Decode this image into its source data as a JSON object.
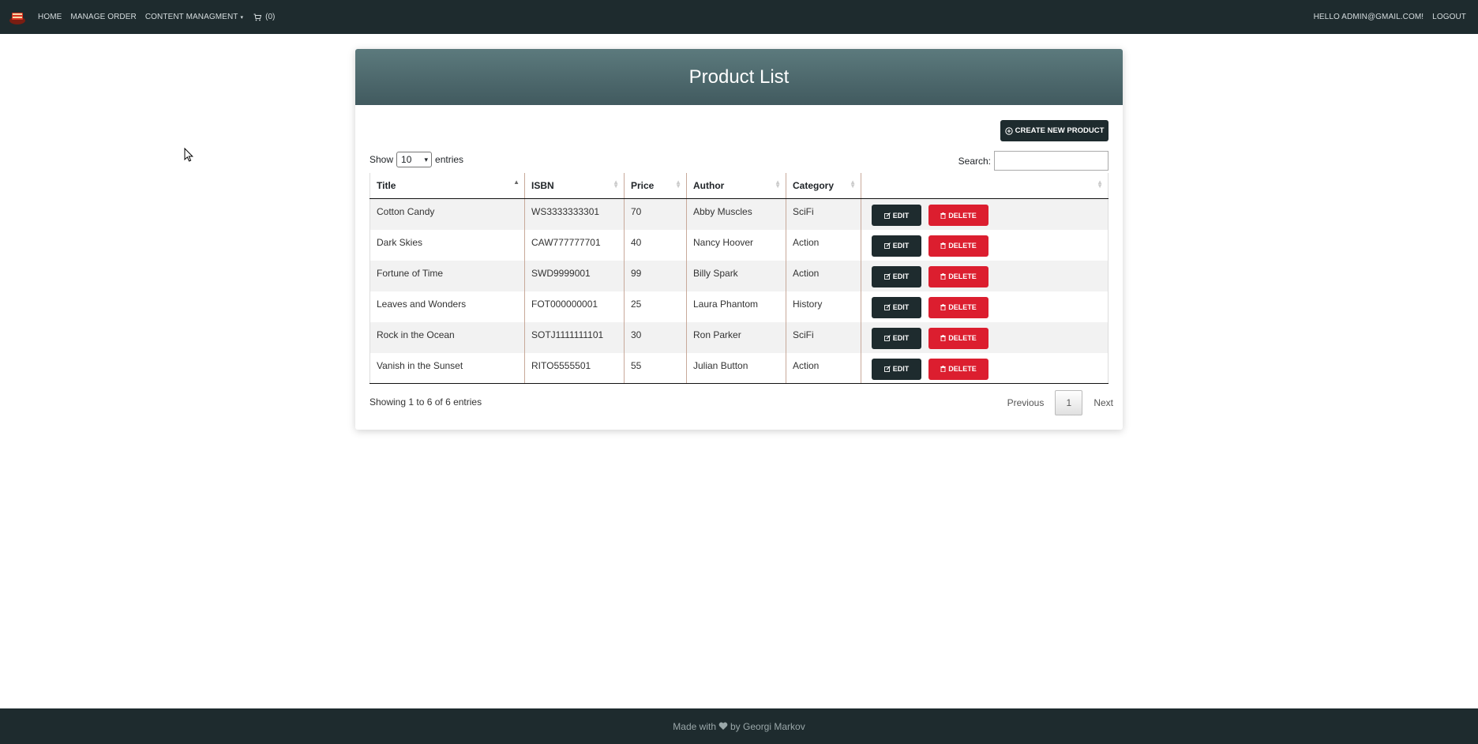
{
  "nav": {
    "home": "HOME",
    "manage_order": "MANAGE ORDER",
    "content_management": "CONTENT MANAGMENT",
    "cart_count": "(0)",
    "greeting": "HELLO ADMIN@GMAIL.COM!",
    "logout": "LOGOUT"
  },
  "page": {
    "title": "Product List",
    "create_label": "CREATE NEW PRODUCT"
  },
  "controls": {
    "show_label": "Show",
    "entries_value": "10",
    "entries_label": "entries",
    "search_label": "Search:",
    "search_value": ""
  },
  "table": {
    "columns": [
      "Title",
      "ISBN",
      "Price",
      "Author",
      "Category"
    ],
    "rows": [
      {
        "title": "Cotton Candy",
        "isbn": "WS3333333301",
        "price": "70",
        "author": "Abby Muscles",
        "category": "SciFi"
      },
      {
        "title": "Dark Skies",
        "isbn": "CAW777777701",
        "price": "40",
        "author": "Nancy Hoover",
        "category": "Action"
      },
      {
        "title": "Fortune of Time",
        "isbn": "SWD9999001",
        "price": "99",
        "author": "Billy Spark",
        "category": "Action"
      },
      {
        "title": "Leaves and Wonders",
        "isbn": "FOT000000001",
        "price": "25",
        "author": "Laura Phantom",
        "category": "History"
      },
      {
        "title": "Rock in the Ocean",
        "isbn": "SOTJ1111111101",
        "price": "30",
        "author": "Ron Parker",
        "category": "SciFi"
      },
      {
        "title": "Vanish in the Sunset",
        "isbn": "RITO5555501",
        "price": "55",
        "author": "Julian Button",
        "category": "Action"
      }
    ],
    "edit_label": "EDIT",
    "delete_label": "DELETE"
  },
  "footer": {
    "info": "Showing 1 to 6 of 6 entries",
    "prev": "Previous",
    "page": "1",
    "next": "Next",
    "made_with": "Made with",
    "by": "by Georgi Markov"
  },
  "colors": {
    "navbar": "#1e2b2e",
    "header_gradient_top": "#5c7a7d",
    "delete": "#dc1e2f",
    "edit": "#1e2b2e"
  }
}
